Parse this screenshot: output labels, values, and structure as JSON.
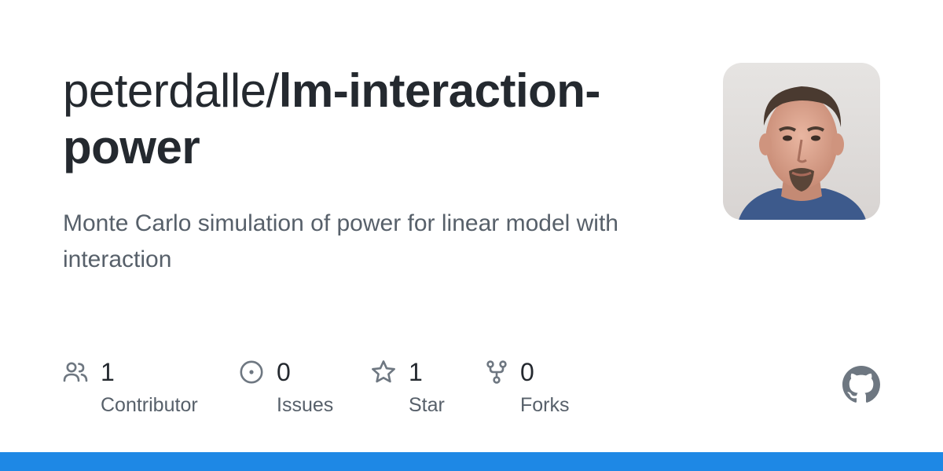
{
  "repo": {
    "owner": "peterdalle/",
    "name": "lm-interaction-power",
    "description": "Monte Carlo simulation of power for linear model with interaction"
  },
  "stats": [
    {
      "icon": "people-icon",
      "count": "1",
      "label": "Contributor"
    },
    {
      "icon": "issue-icon",
      "count": "0",
      "label": "Issues"
    },
    {
      "icon": "star-icon",
      "count": "1",
      "label": "Star"
    },
    {
      "icon": "fork-icon",
      "count": "0",
      "label": "Forks"
    }
  ],
  "colors": {
    "title": "#24292f",
    "muted": "#57606a",
    "icon": "#6e7781",
    "accent_bar": "#1e88e5"
  }
}
